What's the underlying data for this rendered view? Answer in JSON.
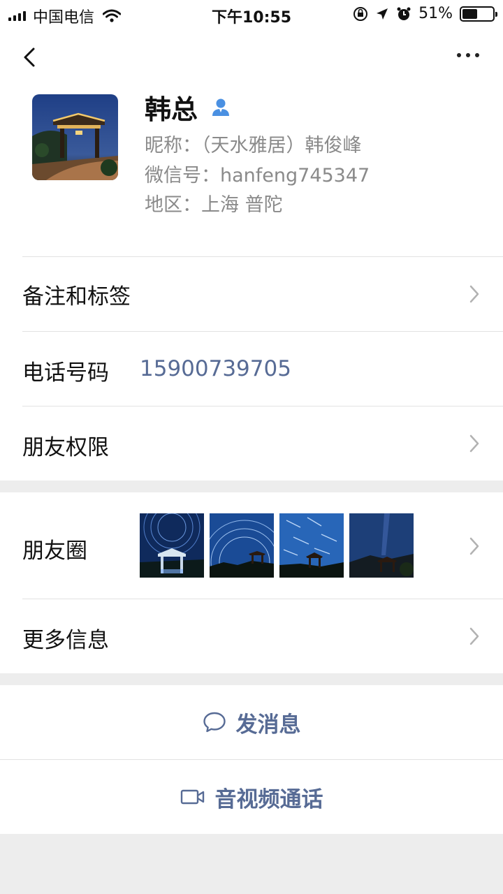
{
  "status_bar": {
    "carrier": "中国电信",
    "time": "下午10:55",
    "battery_percent": "51%",
    "battery_level": 0.51,
    "icons": [
      "signal-icon",
      "wifi-icon",
      "orientation-lock-icon",
      "location-icon",
      "alarm-icon",
      "battery-icon"
    ]
  },
  "nav": {
    "back_icon": "chevron-left-icon",
    "more_icon": "more-dots-icon"
  },
  "profile": {
    "name": "韩总",
    "badge_icon": "person-icon",
    "nickname": "昵称：（天水雅居）韩俊峰",
    "wechat_id": "微信号：hanfeng745347",
    "region": "地区：上海 普陀"
  },
  "rows": {
    "remarks_tags": "备注和标签",
    "phone_label": "电话号码",
    "phone_value": "15900739705",
    "friend_permissions": "朋友权限",
    "moments": "朋友圈",
    "more_info": "更多信息"
  },
  "actions": {
    "send_message": "发消息",
    "av_call": "音视频通话"
  },
  "colors": {
    "link_blue": "#576b95",
    "background_gray": "#ededed",
    "badge_blue": "#4a90e2"
  }
}
